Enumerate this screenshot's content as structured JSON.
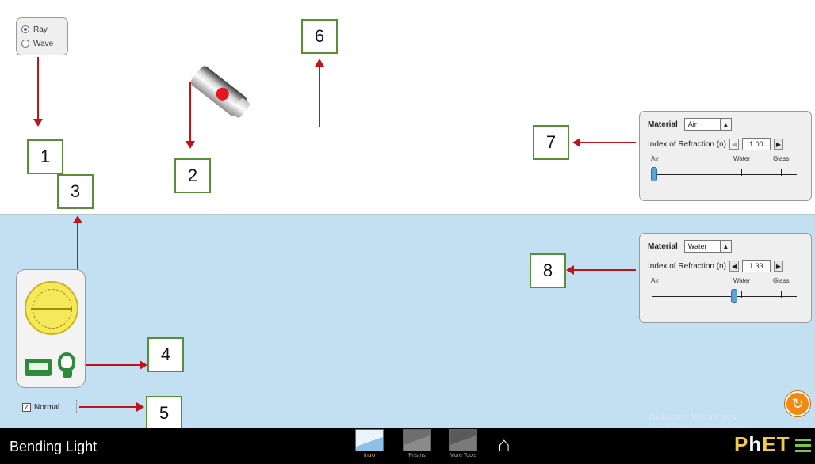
{
  "radio_group": {
    "options": [
      "Ray",
      "Wave"
    ],
    "selected": "Ray"
  },
  "callouts": [
    "1",
    "2",
    "3",
    "4",
    "5",
    "6",
    "7",
    "8"
  ],
  "top_medium": {
    "material_label": "Material",
    "material_value": "Air",
    "index_label": "Index of Refraction (n)",
    "index_value": "1.00",
    "scale_labels": [
      "Air",
      "Water",
      "Glass"
    ],
    "slider_fraction": 0.0
  },
  "bottom_medium": {
    "material_label": "Material",
    "material_value": "Water",
    "index_label": "Index of Refraction (n)",
    "index_value": "1.33",
    "scale_labels": [
      "Air",
      "Water",
      "Glass"
    ],
    "slider_fraction": 0.55
  },
  "normal_checkbox": {
    "label": "Normal",
    "checked": true
  },
  "watermark": {
    "line1": "Activate Windows",
    "line2": "Go to Settings to activate Windows."
  },
  "navbar": {
    "app_title": "Bending Light",
    "screens": [
      {
        "label": "Intro",
        "active": true
      },
      {
        "label": "Prisms",
        "active": false
      },
      {
        "label": "More Tools",
        "active": false
      }
    ],
    "brand": "PhET"
  },
  "colors": {
    "arrow": "#c0141c",
    "water": "#c3dff2",
    "callout_border": "#5a8d38",
    "navbar": "#000000"
  },
  "icons": [
    "laser-pointer-icon",
    "protractor-icon",
    "intensity-meter-icon",
    "light-bulb-icon",
    "reset-all-icon",
    "home-icon",
    "menu-icon"
  ]
}
